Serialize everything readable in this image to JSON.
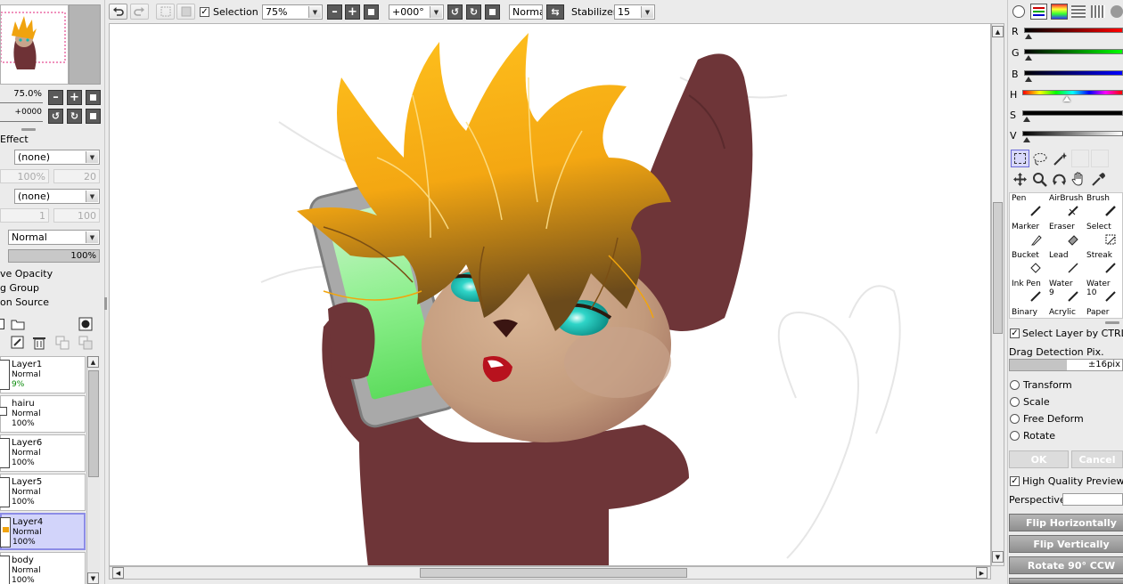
{
  "toolbar": {
    "selection_label": "Selection",
    "zoom_value": "75%",
    "rotation_value": "+000°",
    "blend_value": "Normal",
    "stabilizer_label": "Stabilizer",
    "stabilizer_value": "15"
  },
  "navigator": {
    "zoom_value": "75.0%",
    "rotation_value": "+0000"
  },
  "layer_panel": {
    "effect_label": "Effect",
    "texture_value": "(none)",
    "texture_pct": "100%",
    "texture_num": "20",
    "effect_value": "(none)",
    "effect_num1": "1",
    "effect_num2": "100",
    "mode_value": "Normal",
    "opacity_value": "100%",
    "option_preserve_opacity": "ve Opacity",
    "option_clipping_group": "g Group",
    "option_selection_source": "on Source",
    "layers": [
      {
        "name": "Layer1",
        "mode": "Normal",
        "opacity": "9%"
      },
      {
        "name": "hairu",
        "mode": "Normal",
        "opacity": "100%"
      },
      {
        "name": "Layer6",
        "mode": "Normal",
        "opacity": "100%"
      },
      {
        "name": "Layer5",
        "mode": "Normal",
        "opacity": "100%"
      },
      {
        "name": "Layer4",
        "mode": "Normal",
        "opacity": "100%"
      },
      {
        "name": "body",
        "mode": "Normal",
        "opacity": "100%"
      }
    ]
  },
  "color_panel": {
    "r_label": "R",
    "g_label": "G",
    "b_label": "B",
    "h_label": "H",
    "s_label": "S",
    "v_label": "V",
    "red": "#d80000",
    "green": "#00a800",
    "blue": "#0000c8"
  },
  "brushes": [
    {
      "name": "Pen",
      "sub": ""
    },
    {
      "name": "AirBrush",
      "sub": ""
    },
    {
      "name": "Brush",
      "sub": ""
    },
    {
      "name": "Marker",
      "sub": ""
    },
    {
      "name": "Eraser",
      "sub": ""
    },
    {
      "name": "Select",
      "sub": ""
    },
    {
      "name": "Bucket",
      "sub": ""
    },
    {
      "name": "Lead",
      "sub": ""
    },
    {
      "name": "Streak",
      "sub": ""
    },
    {
      "name": "Ink Pen",
      "sub": ""
    },
    {
      "name": "Water",
      "sub": "9"
    },
    {
      "name": "Water",
      "sub": "10"
    },
    {
      "name": "Binary",
      "sub": ""
    },
    {
      "name": "Acrylic",
      "sub": ""
    },
    {
      "name": "Paper",
      "sub": ""
    }
  ],
  "tool_options": {
    "select_layer_label": "Select Layer by CTRL+L",
    "drag_detection_label": "Drag Detection Pix.",
    "drag_detection_value": "±16pix",
    "transform_label": "Transform",
    "scale_label": "Scale",
    "free_deform_label": "Free Deform",
    "rotate_label": "Rotate",
    "ok_label": "OK",
    "cancel_label": "Cancel",
    "hq_preview_label": "High Quality Preview",
    "perspective_label": "Perspective",
    "flip_h_label": "Flip Horizontally",
    "flip_v_label": "Flip Vertically",
    "rotate_ccw_label": "Rotate 90° CCW"
  }
}
